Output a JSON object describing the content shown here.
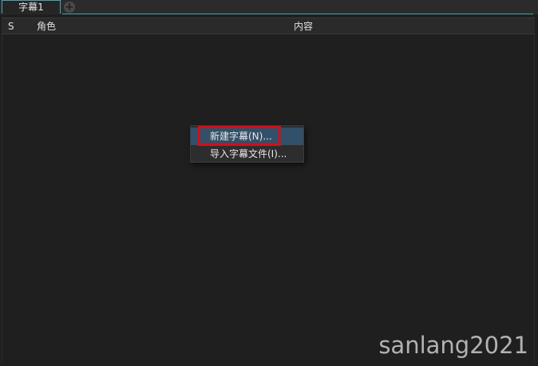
{
  "tabs": [
    {
      "label": "字幕1",
      "active": true
    }
  ],
  "add_tab_icon": "plus-circle-icon",
  "table": {
    "columns": [
      "S",
      "角色",
      "内容"
    ],
    "rows": []
  },
  "context_menu": {
    "items": [
      {
        "label": "新建字幕(N)...",
        "highlighted": true
      },
      {
        "label": "导入字幕文件(I)..."
      }
    ]
  },
  "watermark": "sanlang2021",
  "colors": {
    "accent": "#3aa9b8",
    "menu_hover": "#32506a",
    "annotation_box": "#d0101a",
    "background": "#1f1f1f"
  }
}
